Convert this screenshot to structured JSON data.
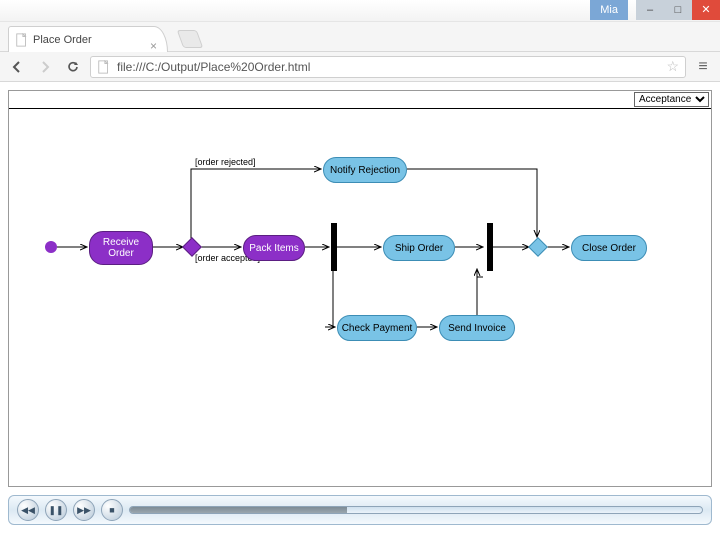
{
  "window": {
    "profile_name": "Mia",
    "min_label": "–",
    "max_label": "□",
    "close_label": "✕"
  },
  "browser": {
    "tab_title": "Place Order",
    "tab_close": "×",
    "url": "file:///C:/Output/Place%20Order.html",
    "star": "☆",
    "menu": "≡"
  },
  "dropdown": {
    "selected": "Acceptance"
  },
  "diagram": {
    "guards": {
      "rejected": "[order rejected]",
      "accepted": "[order accepted]"
    },
    "nodes": {
      "receive_order": "Receive Order",
      "pack_items": "Pack Items",
      "notify_rejection": "Notify Rejection",
      "ship_order": "Ship Order",
      "check_payment": "Check Payment",
      "send_invoice": "Send Invoice",
      "close_order": "Close Order"
    }
  },
  "player": {
    "rewind": "◀◀",
    "pause": "❚❚",
    "forward": "▶▶",
    "stop": "■"
  }
}
